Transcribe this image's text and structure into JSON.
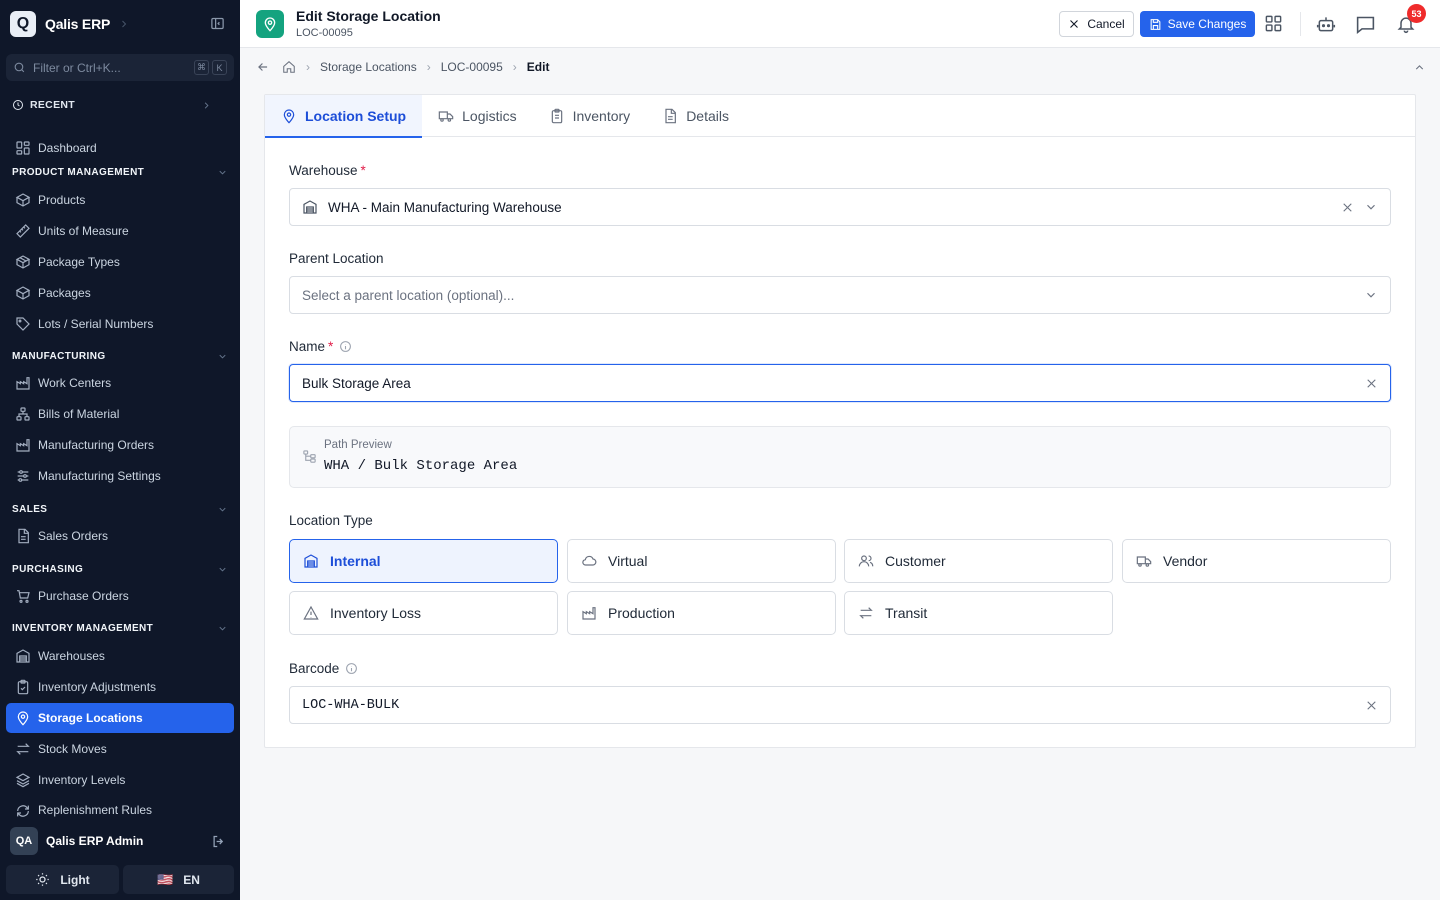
{
  "app": {
    "name": "Qalis ERP"
  },
  "sidebar": {
    "filter_placeholder": "Filter or Ctrl+K...",
    "shortcut_keys": [
      "⌘",
      "K"
    ],
    "recent_label": "RECENT",
    "dashboard_label": "Dashboard",
    "sections": {
      "product_management": "PRODUCT MANAGEMENT",
      "manufacturing": "MANUFACTURING",
      "sales": "SALES",
      "purchasing": "PURCHASING",
      "inventory_management": "INVENTORY MANAGEMENT"
    },
    "items": {
      "products": "Products",
      "units_of_measure": "Units of Measure",
      "package_types": "Package Types",
      "packages": "Packages",
      "lots_serial_numbers": "Lots / Serial Numbers",
      "work_centers": "Work Centers",
      "bills_of_material": "Bills of Material",
      "manufacturing_orders": "Manufacturing Orders",
      "manufacturing_settings": "Manufacturing Settings",
      "sales_orders": "Sales Orders",
      "purchase_orders": "Purchase Orders",
      "warehouses": "Warehouses",
      "inventory_adjustments": "Inventory Adjustments",
      "storage_locations": "Storage Locations",
      "stock_moves": "Stock Moves",
      "inventory_levels": "Inventory Levels",
      "replenishment_rules": "Replenishment Rules"
    },
    "user": {
      "initials": "QA",
      "name": "Qalis ERP Admin"
    },
    "theme_label": "Light",
    "language_label": "EN",
    "flag": "🇺🇸",
    "colors": {
      "background": "#0f1729",
      "active": "#2563eb"
    }
  },
  "header": {
    "title": "Edit Storage Location",
    "subtitle": "LOC-00095",
    "cancel_label": "Cancel",
    "save_label": "Save Changes",
    "notification_count": "53",
    "colors": {
      "primary": "#2563eb",
      "page_icon": "#14a37f",
      "badge": "#ef2b2b"
    }
  },
  "breadcrumb": {
    "items": [
      "Storage Locations",
      "LOC-00095"
    ],
    "current": "Edit"
  },
  "tabs": [
    "Location Setup",
    "Logistics",
    "Inventory",
    "Details"
  ],
  "active_tab": "Location Setup",
  "form": {
    "warehouse": {
      "label": "Warehouse",
      "value": "WHA - Main Manufacturing Warehouse"
    },
    "parent_location": {
      "label": "Parent Location",
      "placeholder": "Select a parent location (optional)..."
    },
    "name": {
      "label": "Name",
      "value": "Bulk Storage Area"
    },
    "path_preview": {
      "label": "Path Preview",
      "value": "WHA / Bulk Storage Area"
    },
    "location_type": {
      "label": "Location Type",
      "options": [
        "Internal",
        "Virtual",
        "Customer",
        "Vendor",
        "Inventory Loss",
        "Production",
        "Transit"
      ],
      "selected": "Internal"
    },
    "barcode": {
      "label": "Barcode",
      "value": "LOC-WHA-BULK"
    }
  }
}
